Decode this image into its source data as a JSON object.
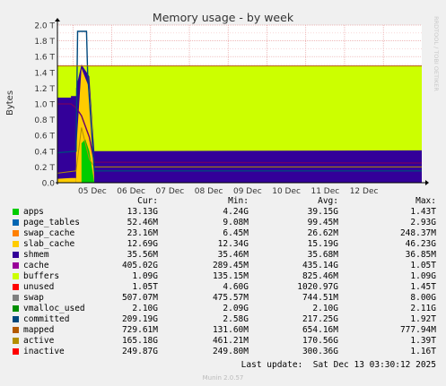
{
  "chart_data": {
    "type": "area",
    "title": "Memory usage - by week",
    "ylabel": "Bytes",
    "xlabel": "",
    "side_label": "RRDTOOL / TOBI OETIKER",
    "ylim": [
      0,
      2.0
    ],
    "y_unit": "T",
    "yticks": [
      "0.0",
      "0.2 T",
      "0.4 T",
      "0.6 T",
      "0.8 T",
      "1.0 T",
      "1.2 T",
      "1.4 T",
      "1.6 T",
      "1.8 T",
      "2.0 T"
    ],
    "xticks": [
      "05 Dec",
      "06 Dec",
      "07 Dec",
      "08 Dec",
      "09 Dec",
      "10 Dec",
      "11 Dec",
      "12 Dec"
    ],
    "x_range_days": [
      3.6,
      12.99
    ],
    "grid": true,
    "stack_order": [
      "apps",
      "page_tables",
      "swap_cache",
      "slab_cache",
      "shmem",
      "cache",
      "buffers",
      "unused"
    ],
    "stacked_steady_T": {
      "apps": 0.013,
      "page_tables": 5e-05,
      "swap_cache": 2e-05,
      "slab_cache": 0.013,
      "shmem": 4e-05,
      "cache": 0.405,
      "buffers": 0.001,
      "unused": 1.05
    },
    "lines_steady_T": {
      "swap": 0.507,
      "vmalloc_used": 0.0021,
      "committed": 0.209,
      "mapped": 0.00073,
      "active": 0.165,
      "inactive": 0.25
    },
    "headers": {
      "cur": "Cur:",
      "min": "Min:",
      "avg": "Avg:",
      "max": "Max:"
    },
    "legend": [
      {
        "name": "apps",
        "color": "#00cc00",
        "cur": "13.13G",
        "min": "4.24G",
        "avg": "39.15G",
        "max": "1.43T"
      },
      {
        "name": "page_tables",
        "color": "#0066b3",
        "cur": "52.46M",
        "min": "9.08M",
        "avg": "99.45M",
        "max": "2.93G"
      },
      {
        "name": "swap_cache",
        "color": "#ff8000",
        "cur": "23.16M",
        "min": "6.45M",
        "avg": "26.62M",
        "max": "248.37M"
      },
      {
        "name": "slab_cache",
        "color": "#ffcc00",
        "cur": "12.69G",
        "min": "12.34G",
        "avg": "15.19G",
        "max": "46.23G"
      },
      {
        "name": "shmem",
        "color": "#330099",
        "cur": "35.56M",
        "min": "35.46M",
        "avg": "35.68M",
        "max": "36.85M"
      },
      {
        "name": "cache",
        "color": "#990099",
        "cur": "405.02G",
        "min": "289.45M",
        "avg": "435.14G",
        "max": "1.05T"
      },
      {
        "name": "buffers",
        "color": "#ccff00",
        "cur": "1.09G",
        "min": "135.15M",
        "avg": "825.46M",
        "max": "1.09G"
      },
      {
        "name": "unused",
        "color": "#ff0000",
        "cur": "1.05T",
        "min": "4.60G",
        "avg": "1020.97G",
        "max": "1.45T"
      },
      {
        "name": "swap",
        "color": "#808080",
        "cur": "507.07M",
        "min": "475.57M",
        "avg": "744.51M",
        "max": "8.00G"
      },
      {
        "name": "vmalloc_used",
        "color": "#008f00",
        "cur": "2.10G",
        "min": "2.09G",
        "avg": "2.10G",
        "max": "2.11G"
      },
      {
        "name": "committed",
        "color": "#00487d",
        "cur": "209.19G",
        "min": "2.58G",
        "avg": "217.25G",
        "max": "1.92T"
      },
      {
        "name": "mapped",
        "color": "#b35a00",
        "cur": "729.61M",
        "min": "131.60M",
        "avg": "654.16M",
        "max": "777.94M"
      },
      {
        "name": "active",
        "color": "#b38f00",
        "cur": "165.18G",
        "min": "461.21M",
        "avg": "170.56G",
        "max": "1.39T"
      },
      {
        "name": "inactive",
        "color": "#6b006b",
        "cur": "249.87G",
        "min": "249.80M",
        "avg": "300.36G",
        "max": "1.16T"
      }
    ],
    "legend_display_colors": [
      "#00cc00",
      "#0066b3",
      "#ff8000",
      "#ffcc00",
      "#330099",
      "#990099",
      "#ccff00",
      "#ff0000",
      "#808080",
      "#008f00",
      "#00487d",
      "#b35a00",
      "#b38f00",
      "#ff0000"
    ],
    "last_update": "Last update:  Sat Dec 13 03:30:12 2025",
    "footer": "Munin 2.0.57"
  }
}
